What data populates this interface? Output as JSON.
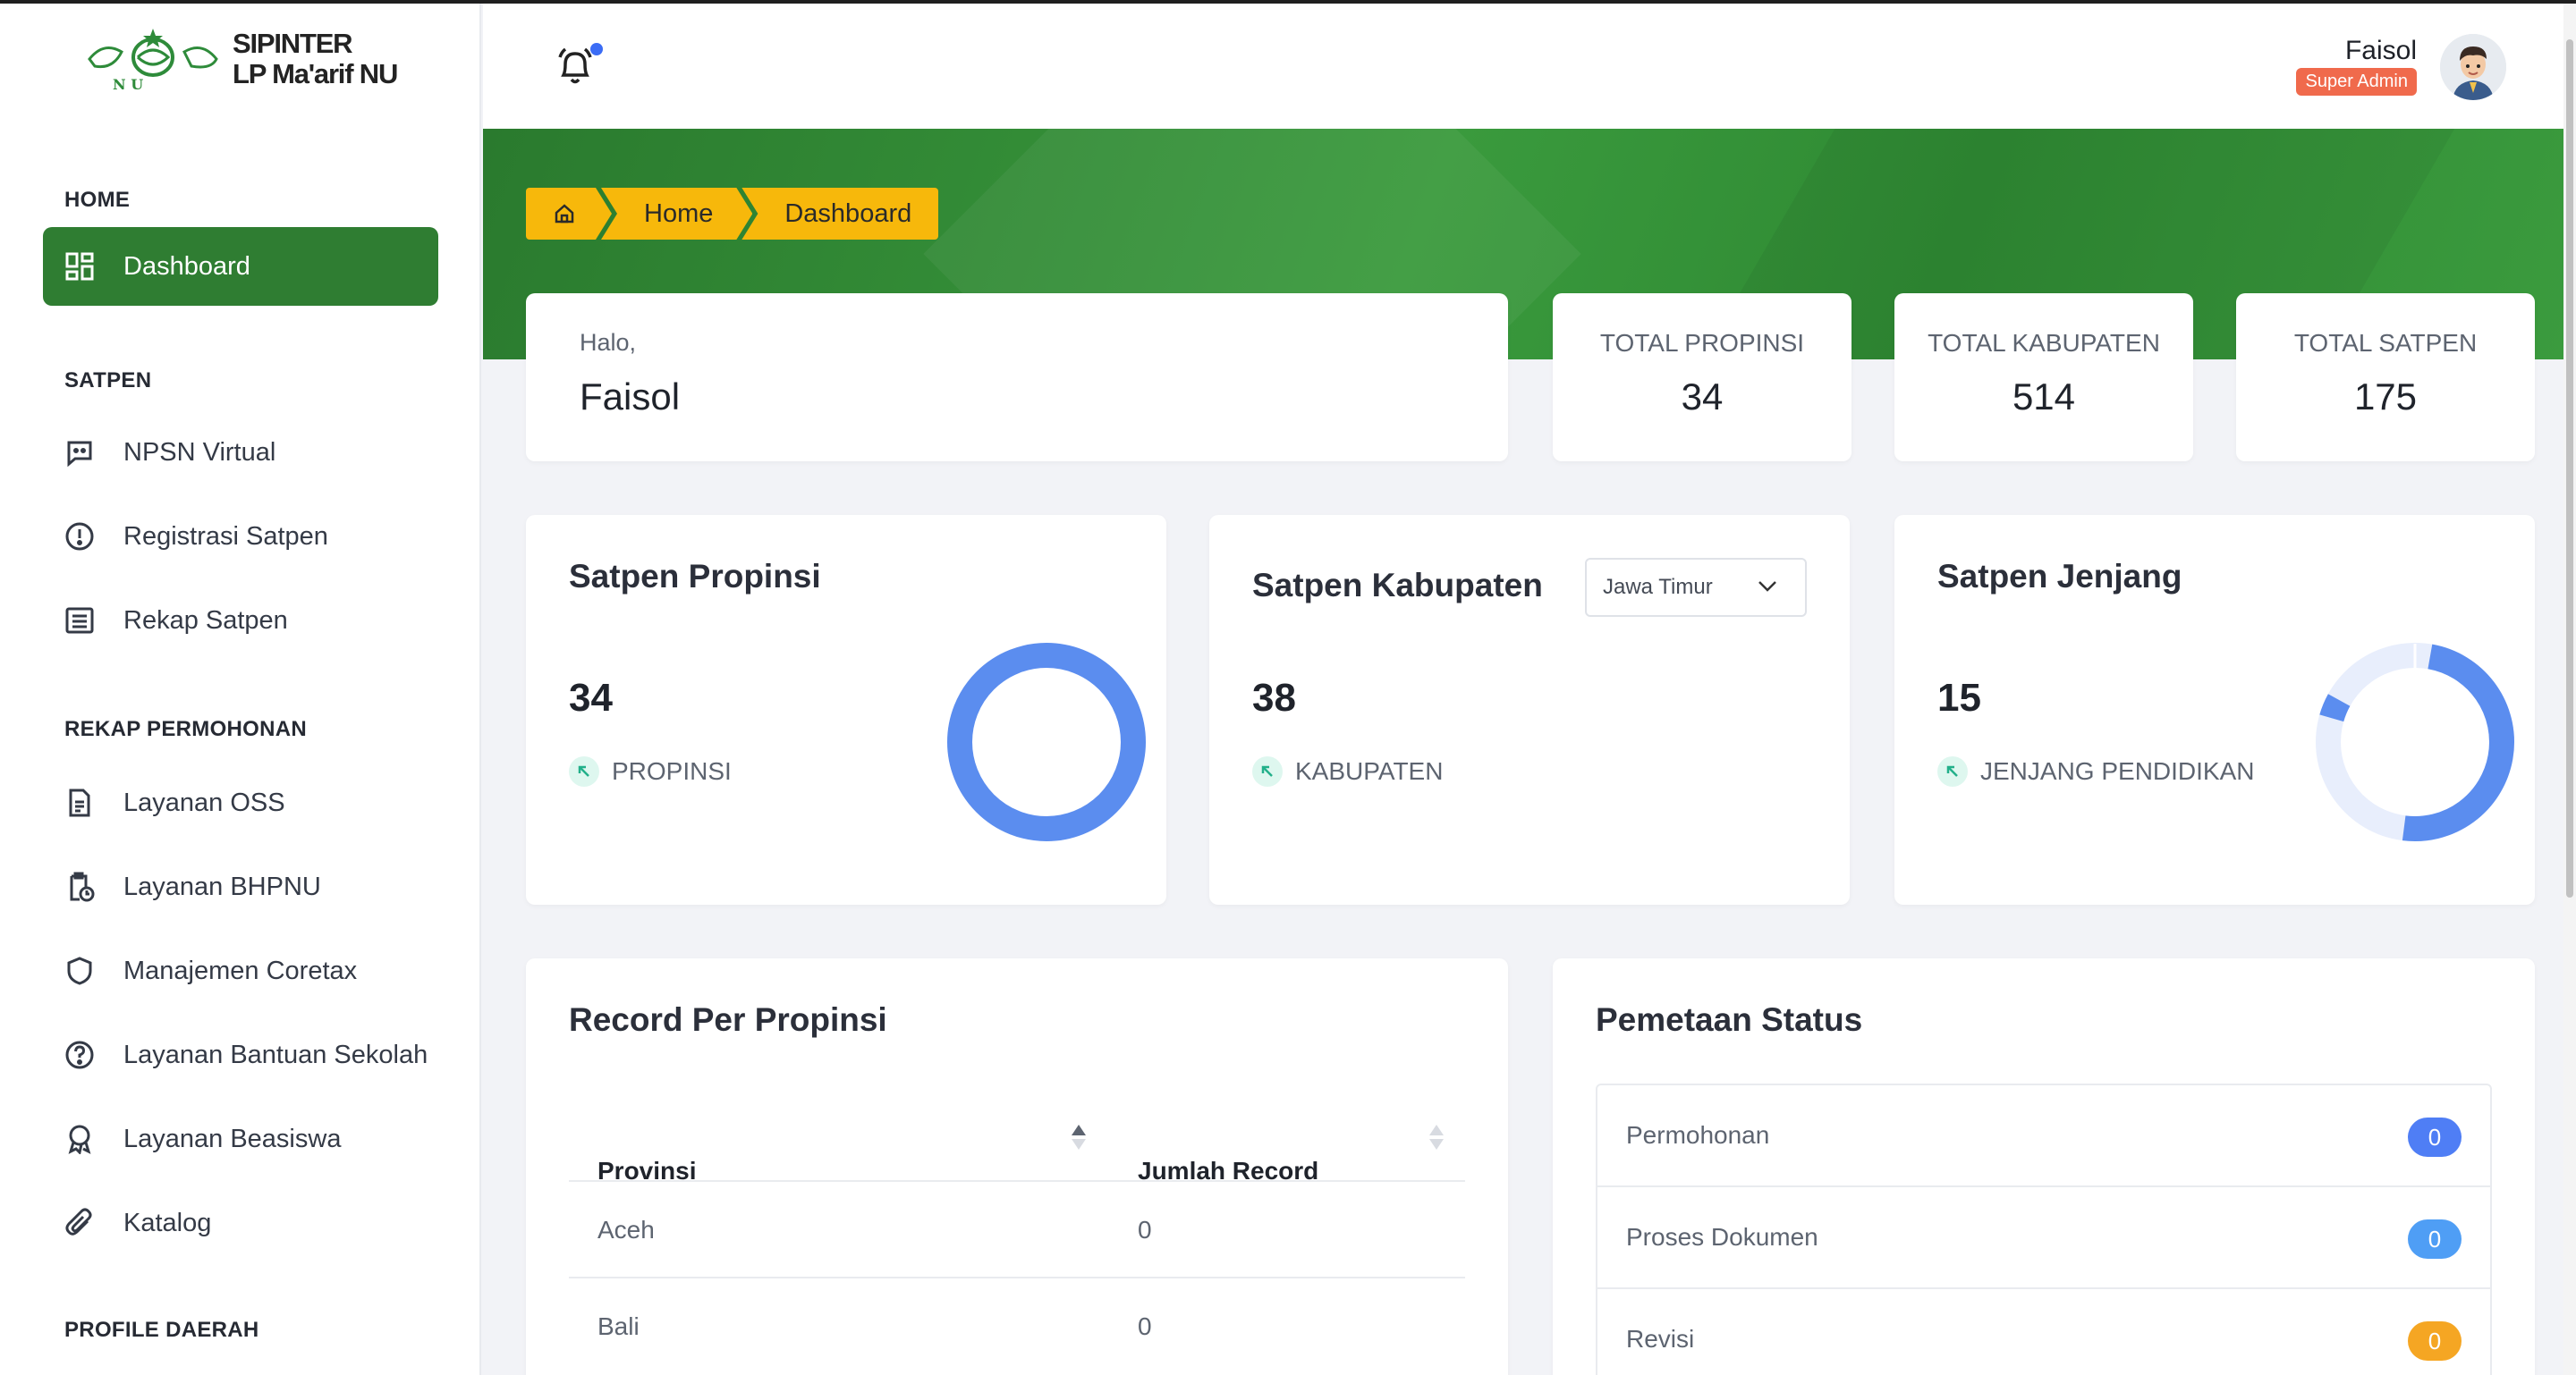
{
  "brand": {
    "line1": "SIPINTER",
    "line2": "LP Ma'arif NU",
    "logo_letters": "N U"
  },
  "user": {
    "name": "Faisol",
    "role": "Super Admin"
  },
  "sidebar": {
    "sections": [
      {
        "label": "HOME"
      },
      {
        "label": "SATPEN"
      },
      {
        "label": "REKAP PERMOHONAN"
      },
      {
        "label": "PROFILE DAERAH"
      }
    ],
    "items": [
      {
        "label": "Dashboard",
        "icon": "dashboard-icon"
      },
      {
        "label": "NPSN Virtual",
        "icon": "message-icon"
      },
      {
        "label": "Registrasi Satpen",
        "icon": "alert-circle-icon"
      },
      {
        "label": "Rekap Satpen",
        "icon": "list-icon"
      },
      {
        "label": "Layanan OSS",
        "icon": "file-icon"
      },
      {
        "label": "Layanan BHPNU",
        "icon": "clipboard-clock-icon"
      },
      {
        "label": "Manajemen Coretax",
        "icon": "shield-icon"
      },
      {
        "label": "Layanan Bantuan Sekolah",
        "icon": "help-circle-icon"
      },
      {
        "label": "Layanan Beasiswa",
        "icon": "award-icon"
      },
      {
        "label": "Katalog",
        "icon": "paperclip-icon"
      }
    ]
  },
  "breadcrumb": {
    "home_icon": "home-icon",
    "items": [
      "Home",
      "Dashboard"
    ]
  },
  "greeting": {
    "label": "Halo,",
    "name": "Faisol"
  },
  "stats": [
    {
      "label": "TOTAL PROPINSI",
      "value": "34"
    },
    {
      "label": "TOTAL KABUPATEN",
      "value": "514"
    },
    {
      "label": "TOTAL SATPEN",
      "value": "175"
    }
  ],
  "widgets": {
    "propinsi": {
      "title": "Satpen Propinsi",
      "value": "34",
      "sub": "PROPINSI"
    },
    "kabupaten": {
      "title": "Satpen Kabupaten",
      "value": "38",
      "sub": "KABUPATEN",
      "select_value": "Jawa Timur"
    },
    "jenjang": {
      "title": "Satpen Jenjang",
      "value": "15",
      "sub": "JENJANG PENDIDIKAN"
    }
  },
  "record_table": {
    "title": "Record Per Propinsi",
    "columns": [
      "Provinsi",
      "Jumlah Record"
    ],
    "rows": [
      {
        "provinsi": "Aceh",
        "jumlah": "0"
      },
      {
        "provinsi": "Bali",
        "jumlah": "0"
      }
    ]
  },
  "status_map": {
    "title": "Pemetaan Status",
    "rows": [
      {
        "label": "Permohonan",
        "count": "0",
        "color": "#4f7ef5"
      },
      {
        "label": "Proses Dokumen",
        "count": "0",
        "color": "#4f9ef5"
      },
      {
        "label": "Revisi",
        "count": "0",
        "color": "#f5a623"
      }
    ]
  },
  "colors": {
    "primary_green": "#2f7d32",
    "accent_yellow": "#f7b80b",
    "donut_blue": "#5b8def",
    "role_badge": "#f06a4c"
  }
}
